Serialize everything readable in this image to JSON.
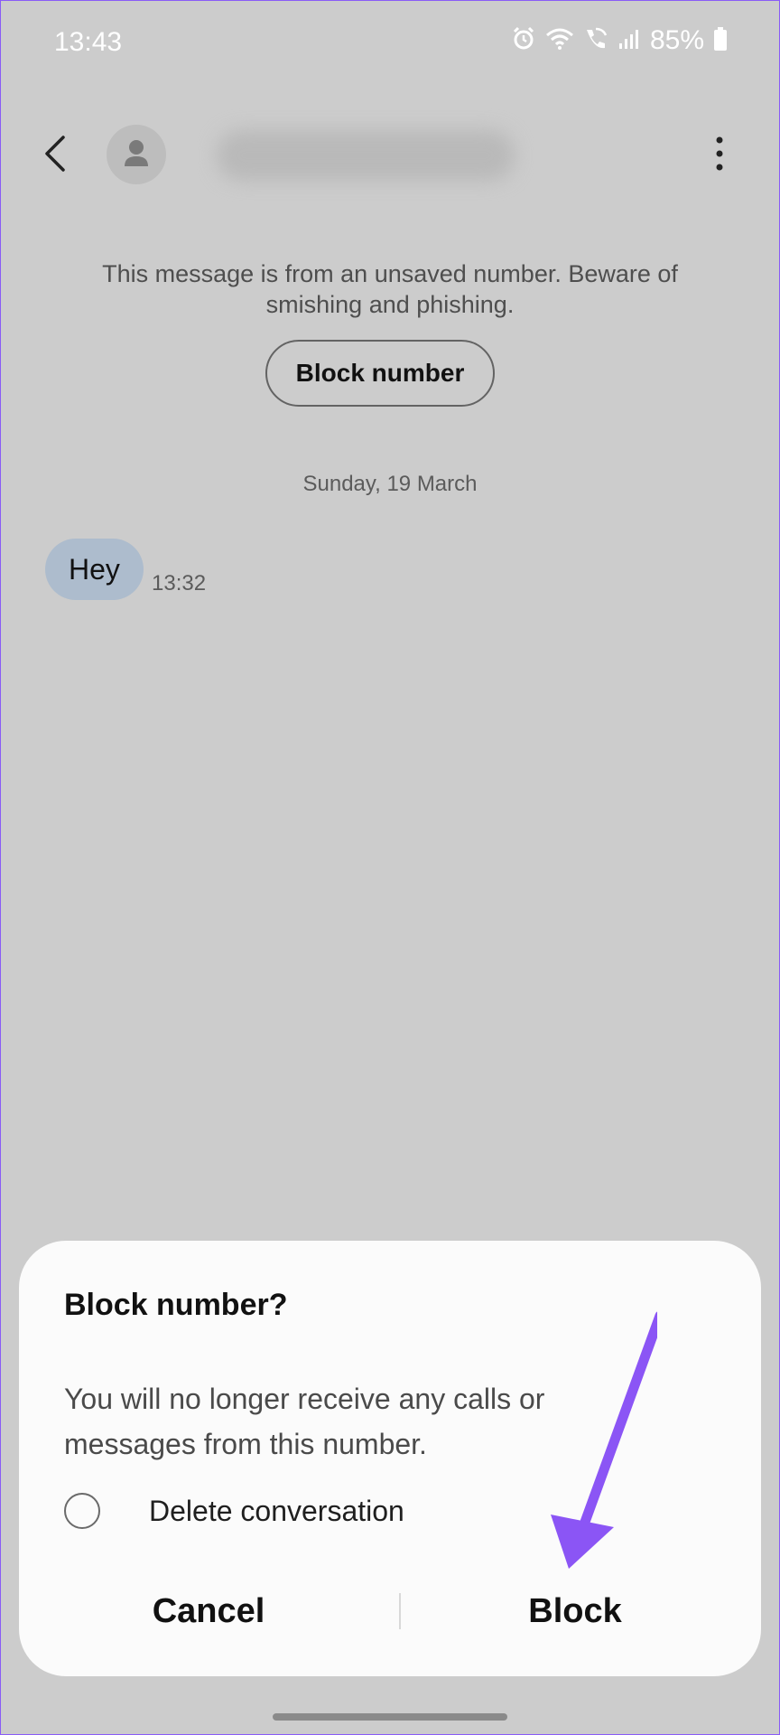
{
  "status_bar": {
    "time": "13:43",
    "icons": [
      "alarm-icon",
      "wifi-icon",
      "wifi-call-icon",
      "signal-icon",
      "battery-icon"
    ],
    "battery_percent": "85%"
  },
  "header": {
    "back_icon": "chevron-left-icon",
    "avatar_icon": "person-icon",
    "more_icon": "kebab-vertical-icon"
  },
  "conversation": {
    "notice_text": "This message is from an unsaved number. Beware of smishing and phishing.",
    "block_number_label": "Block number",
    "date_separator": "Sunday, 19 March",
    "messages": [
      {
        "text": "Hey",
        "time": "13:32"
      }
    ]
  },
  "dialog": {
    "title": "Block number?",
    "message": "You will no longer receive any calls or messages from this number.",
    "delete_conversation_label": "Delete conversation",
    "delete_conversation_checked": false,
    "cancel_label": "Cancel",
    "block_label": "Block"
  },
  "colors": {
    "background_dim": "#cccccc",
    "dialog_bg": "#fbfbfb",
    "bubble": "#adbccd",
    "annotation_arrow": "#8b55f5"
  }
}
